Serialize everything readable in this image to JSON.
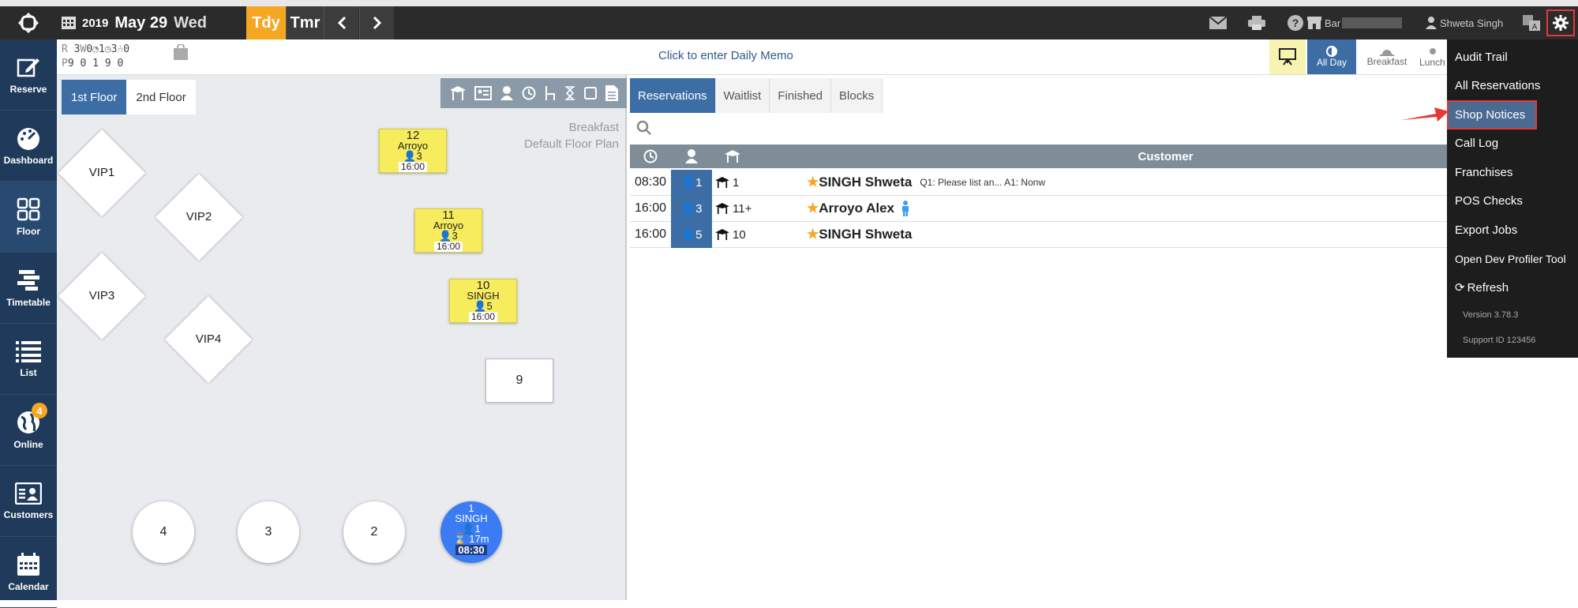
{
  "topbar": {
    "year": "2019",
    "month_day": "May 29",
    "weekday": "Wed",
    "today_label": "Tdy",
    "tomorrow_label": "Tmr",
    "restaurant": "Bar",
    "user": "Shweta Singh"
  },
  "sidebar": {
    "items": [
      {
        "label": "Reserve",
        "icon": "edit-icon"
      },
      {
        "label": "Dashboard",
        "icon": "dashboard-icon"
      },
      {
        "label": "Floor",
        "icon": "floor-grid-icon"
      },
      {
        "label": "Timetable",
        "icon": "timetable-icon"
      },
      {
        "label": "List",
        "icon": "list-icon"
      },
      {
        "label": "Online",
        "icon": "globe-icon",
        "badge": "4"
      },
      {
        "label": "Customers",
        "icon": "customer-card-icon"
      },
      {
        "label": "Calendar",
        "icon": "calendar-icon"
      }
    ]
  },
  "stats": {
    "row1": {
      "r": "R",
      "v1": "3",
      "w": "W",
      "v2": "0",
      "v3": "1",
      "v4": "3",
      "v5": "0"
    },
    "row2": {
      "p": "P",
      "v1": "9",
      "v2": "0",
      "v3": "1",
      "v4": "9",
      "v5": "0"
    }
  },
  "memo": "Click to enter Daily Memo",
  "meals": {
    "all_day": "All Day",
    "breakfast": "Breakfast",
    "lunch": "Lunch"
  },
  "floor": {
    "tabs": [
      "1st Floor",
      "2nd Floor"
    ],
    "info_line1": "Breakfast",
    "info_line2": "Default Floor Plan",
    "diamonds": [
      "VIP1",
      "VIP2",
      "VIP3",
      "VIP4"
    ],
    "yellow_tables": [
      {
        "num": "12",
        "name": "Arroyo",
        "guests": "3",
        "time": "16:00"
      },
      {
        "num": "11",
        "name": "Arroyo",
        "guests": "3",
        "time": "16:00"
      },
      {
        "num": "10",
        "name": "SINGH",
        "guests": "5",
        "time": "16:00"
      }
    ],
    "square_table": "9",
    "round_tables": [
      "4",
      "3",
      "2"
    ],
    "occupied_table": {
      "num": "1",
      "name": "SINGH",
      "guests": "1",
      "elapsed": "17m",
      "time": "08:30"
    }
  },
  "reservations": {
    "tabs": [
      "Reservations",
      "Waitlist",
      "Finished",
      "Blocks"
    ],
    "header_customer": "Customer",
    "rows": [
      {
        "time": "08:30",
        "party": "1",
        "table": "1",
        "name": "SINGH Shweta",
        "note": "Q1: Please list an... A1: Nonw"
      },
      {
        "time": "16:00",
        "party": "3",
        "table": "11+",
        "name": "Arroyo Alex",
        "note": ""
      },
      {
        "time": "16:00",
        "party": "5",
        "table": "10",
        "name": "SINGH Shweta",
        "note": ""
      }
    ]
  },
  "menu": {
    "items": [
      "Audit Trail",
      "All Reservations",
      "Shop Notices",
      "Call Log",
      "Franchises",
      "POS Checks",
      "Export Jobs",
      "Open Dev Profiler Tool",
      "Refresh"
    ],
    "version": "Version 3.78.3",
    "support": "Support ID 123456"
  },
  "colors": {
    "accent_orange": "#f5a623",
    "sidebar_blue": "#1f3a5a",
    "tab_blue": "#3c6ea5",
    "table_yellow": "#f7ec5e",
    "occupied_blue": "#3b7cf5",
    "highlight_red": "#e53935"
  }
}
